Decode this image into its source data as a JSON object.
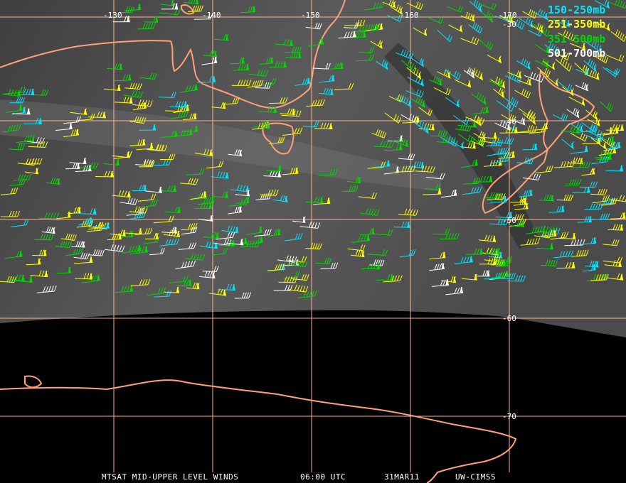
{
  "map": {
    "longitude_labels": [
      "-130",
      "-140",
      "-150",
      "-160",
      "-170"
    ],
    "latitude_labels": [
      "-30",
      "-40",
      "-50",
      "-60",
      "-70"
    ],
    "grid_color": "#ffb090",
    "coastline_color": "#ffa07a",
    "imagery_color": "#4a4a4a"
  },
  "legend": [
    {
      "label": "150-250mb",
      "color": "#00e5ff"
    },
    {
      "label": "251-350mb",
      "color": "#ffff00"
    },
    {
      "label": "351-500mb",
      "color": "#00d800"
    },
    {
      "label": "501-700mb",
      "color": "#ffffff"
    }
  ],
  "footer": {
    "product": "MTSAT MID-UPPER LEVEL WINDS",
    "time": "06:00 UTC",
    "date": "31MAR11",
    "source": "UW-CIMSS"
  }
}
